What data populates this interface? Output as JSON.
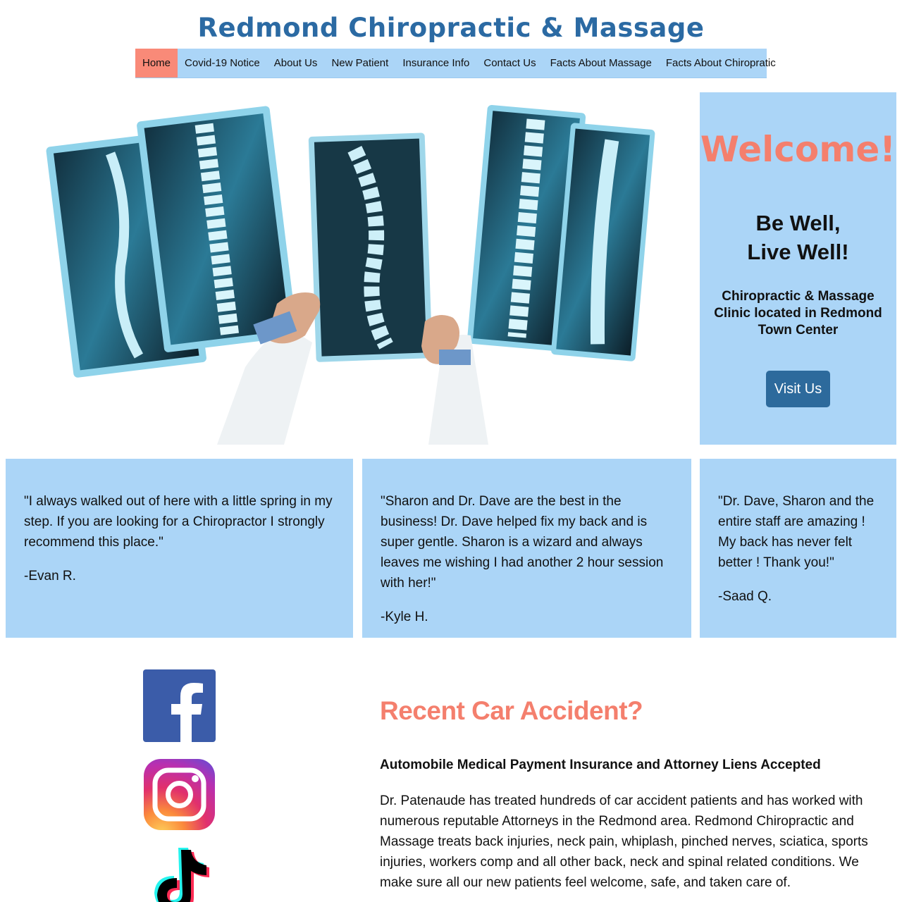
{
  "header": {
    "site_title": "Redmond Chiropractic & Massage"
  },
  "nav": {
    "items": [
      {
        "label": "Home",
        "active": true
      },
      {
        "label": "Covid-19 Notice",
        "active": false
      },
      {
        "label": "About Us",
        "active": false
      },
      {
        "label": "New Patient",
        "active": false
      },
      {
        "label": "Insurance Info",
        "active": false
      },
      {
        "label": "Contact Us",
        "active": false
      },
      {
        "label": "Facts About Massage",
        "active": false
      },
      {
        "label": "Facts About Chiropratic",
        "active": false
      }
    ]
  },
  "hero": {
    "image_icon": "xray-photo-icon"
  },
  "welcome": {
    "title": "Welcome!",
    "tagline_line1": "Be Well,",
    "tagline_line2": "Live Well!",
    "description": "Chiropractic & Massage Clinic located in Redmond Town Center",
    "button_label": "Visit Us"
  },
  "testimonials": [
    {
      "quote": "\"I always walked out of here with a little spring in my step. If you are looking for a Chiropractor I strongly recommend this place.\"",
      "author": "-Evan R."
    },
    {
      "quote": "\"Sharon and Dr. Dave are the best in the business! Dr. Dave helped fix my back and is super gentle. Sharon is a wizard and always leaves me wishing I had another 2 hour session with her!\"",
      "author": "-Kyle H."
    },
    {
      "quote": "\"Dr. Dave, Sharon and the entire staff are amazing ! My back has never felt better ! Thank you!\"",
      "author": "-Saad Q."
    }
  ],
  "social": {
    "facebook_icon": "facebook-icon",
    "instagram_icon": "instagram-icon",
    "tiktok_icon": "tiktok-icon"
  },
  "accident": {
    "title": "Recent Car Accident?",
    "subtitle": "Automobile Medical Payment Insurance and Attorney Liens Accepted",
    "body": "Dr. Patenaude has treated hundreds of car accident patients and has worked with numerous reputable Attorneys in the Redmond area. Redmond Chiropractic and Massage treats back injuries, neck pain, whiplash, pinched nerves, sciatica, sports injuries, workers comp and all other back, neck and spinal related conditions. We make sure all our new patients feel welcome, safe, and taken care of."
  },
  "colors": {
    "brand_blue": "#2b6aa3",
    "panel_blue": "#abd5f7",
    "accent_salmon": "#f47f6d",
    "button_blue": "#2d6a9c"
  }
}
